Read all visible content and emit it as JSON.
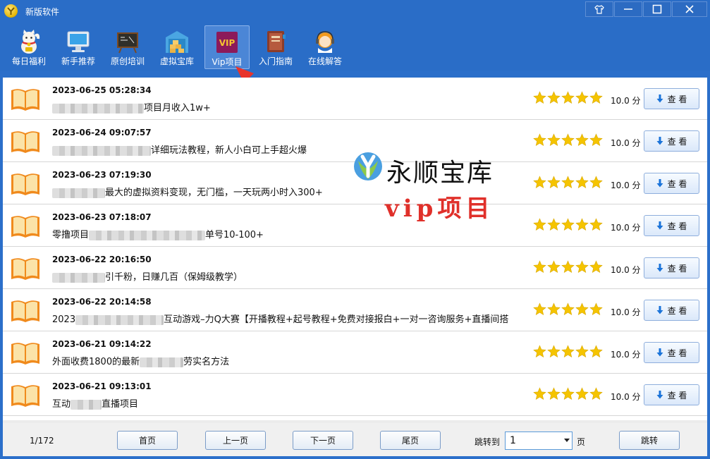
{
  "window": {
    "title": "新版软件"
  },
  "toolbar": {
    "items": [
      {
        "label": "每日福利",
        "icon": "lucky-cat-icon"
      },
      {
        "label": "新手推荐",
        "icon": "monitor-icon"
      },
      {
        "label": "原创培训",
        "icon": "blackboard-icon"
      },
      {
        "label": "虚拟宝库",
        "icon": "warehouse-icon"
      },
      {
        "label": "Vip项目",
        "icon": "vip-icon",
        "badge": "VIP",
        "active": true
      },
      {
        "label": "入门指南",
        "icon": "guide-book-icon"
      },
      {
        "label": "在线解答",
        "icon": "support-agent-icon"
      }
    ]
  },
  "list": {
    "view_label": "查 看",
    "score_label": "10.0 分",
    "rating": 5,
    "items": [
      {
        "date": "2023-06-25 05:28:34",
        "prefix": "",
        "title": "项目月收入1w+"
      },
      {
        "date": "2023-06-24 09:07:57",
        "prefix": "",
        "title": "详细玩法教程，新人小白可上手超火爆"
      },
      {
        "date": "2023-06-23 07:19:30",
        "prefix": "",
        "title": "最大的虚拟资料变现，无门槛，一天玩两小时入300+"
      },
      {
        "date": "2023-06-23 07:18:07",
        "prefix": "零撸项目",
        "title": "单号10-100+"
      },
      {
        "date": "2023-06-22 20:16:50",
        "prefix": "",
        "title": "引千粉，日赚几百（保姆级教学）"
      },
      {
        "date": "2023-06-22 20:14:58",
        "prefix": "2023",
        "title": "互动游戏–力Q大赛【开播教程+起号教程+免费对接报白+一对一咨询服务+直播间搭"
      },
      {
        "date": "2023-06-21 09:14:22",
        "prefix": "外面收费1800的最新",
        "title": "劳实名方法"
      },
      {
        "date": "2023-06-21 09:13:01",
        "prefix": "互动",
        "title": "直播项目"
      }
    ]
  },
  "watermark": {
    "name": "永顺宝库",
    "subtitle": "vip项目"
  },
  "footer": {
    "page_info": "1/172",
    "first": "首页",
    "prev": "上一页",
    "next": "下一页",
    "last": "尾页",
    "jump_label": "跳转到",
    "jump_value": "1",
    "page_unit": "页",
    "jump_button": "跳转"
  },
  "colors": {
    "titlebar": "#2a6dc7",
    "star": "#f5c400",
    "watermark_red": "#e0302a"
  }
}
